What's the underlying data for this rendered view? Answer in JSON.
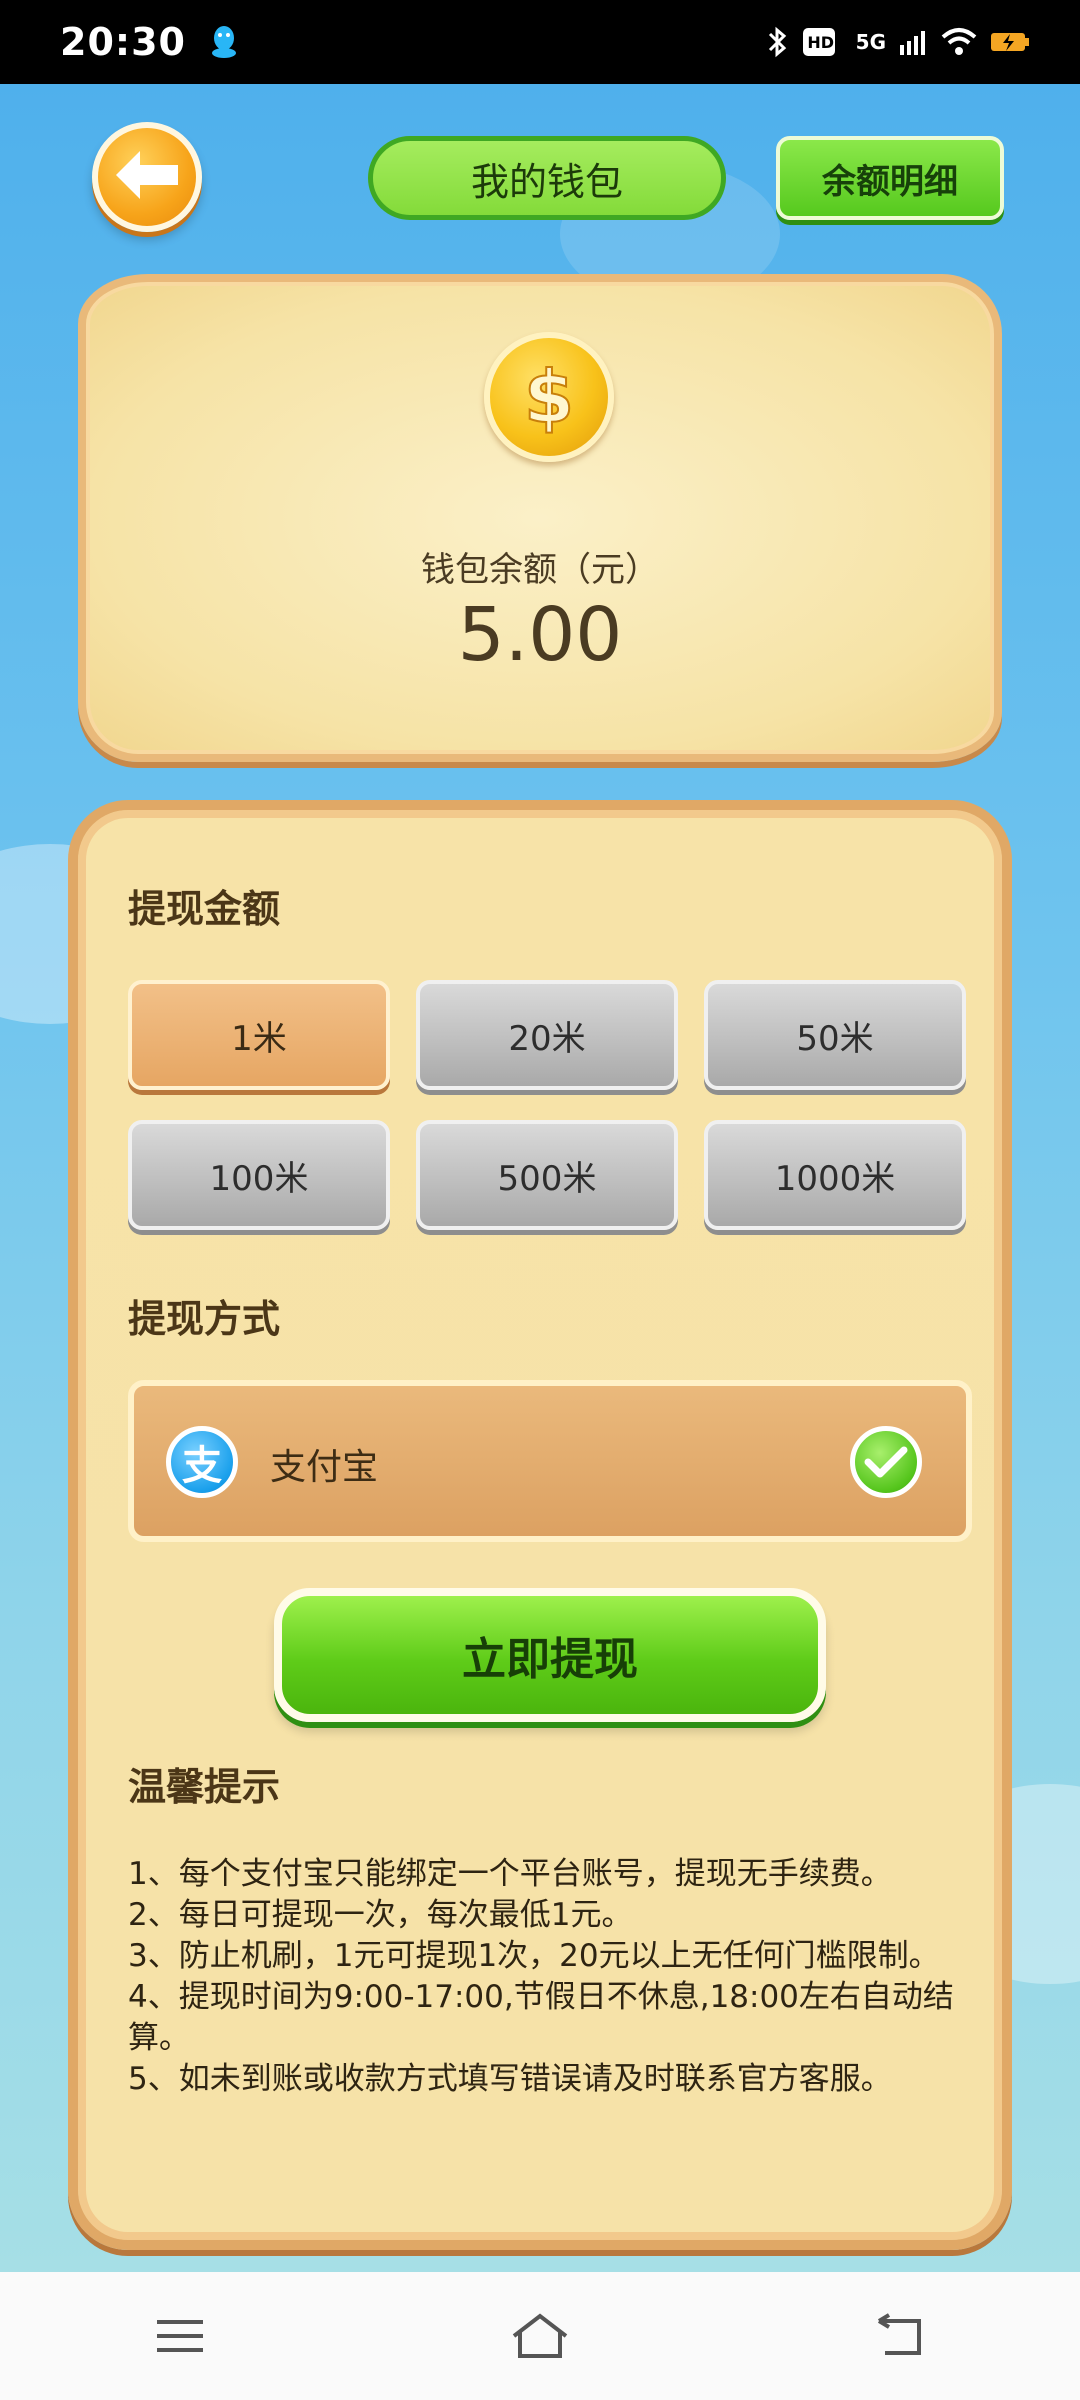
{
  "status_bar": {
    "time": "20:30",
    "network": "5G",
    "hd": "HD",
    "icons": [
      "qq-icon",
      "bluetooth-icon",
      "hd-icon",
      "signal-5g-icon",
      "wifi-icon",
      "battery-charging-icon"
    ]
  },
  "header": {
    "back_icon": "arrow-left-icon",
    "title": "我的钱包",
    "detail_label": "余额明细"
  },
  "balance": {
    "icon": "dollar-coin-icon",
    "label": "钱包余额（元）",
    "value": "5.00"
  },
  "withdraw": {
    "amount_title": "提现金额",
    "amounts": [
      {
        "label": "1米",
        "selected": true
      },
      {
        "label": "20米",
        "selected": false
      },
      {
        "label": "50米",
        "selected": false
      },
      {
        "label": "100米",
        "selected": false
      },
      {
        "label": "500米",
        "selected": false
      },
      {
        "label": "1000米",
        "selected": false
      }
    ],
    "method_title": "提现方式",
    "method": {
      "icon_char": "支",
      "label": "支付宝",
      "selected": true
    },
    "button_label": "立即提现"
  },
  "tips": {
    "title": "温馨提示",
    "items": [
      "1、每个支付宝只能绑定一个平台账号，提现无手续费。",
      "2、每日可提现一次，每次最低1元。",
      "3、防止机刷，1元可提现1次，20元以上无任何门槛限制。",
      "4、提现时间为9:00-17:00,节假日不休息,18:00左右自动结算。",
      "5、如未到账或收款方式填写错误请及时联系官方客服。"
    ]
  },
  "colors": {
    "accent_green": "#5fcc19",
    "selected_amount": "#e6a663",
    "card_bg": "#f6e2a8"
  },
  "nav": {
    "icons": [
      "menu-icon",
      "home-icon",
      "back-icon"
    ]
  }
}
